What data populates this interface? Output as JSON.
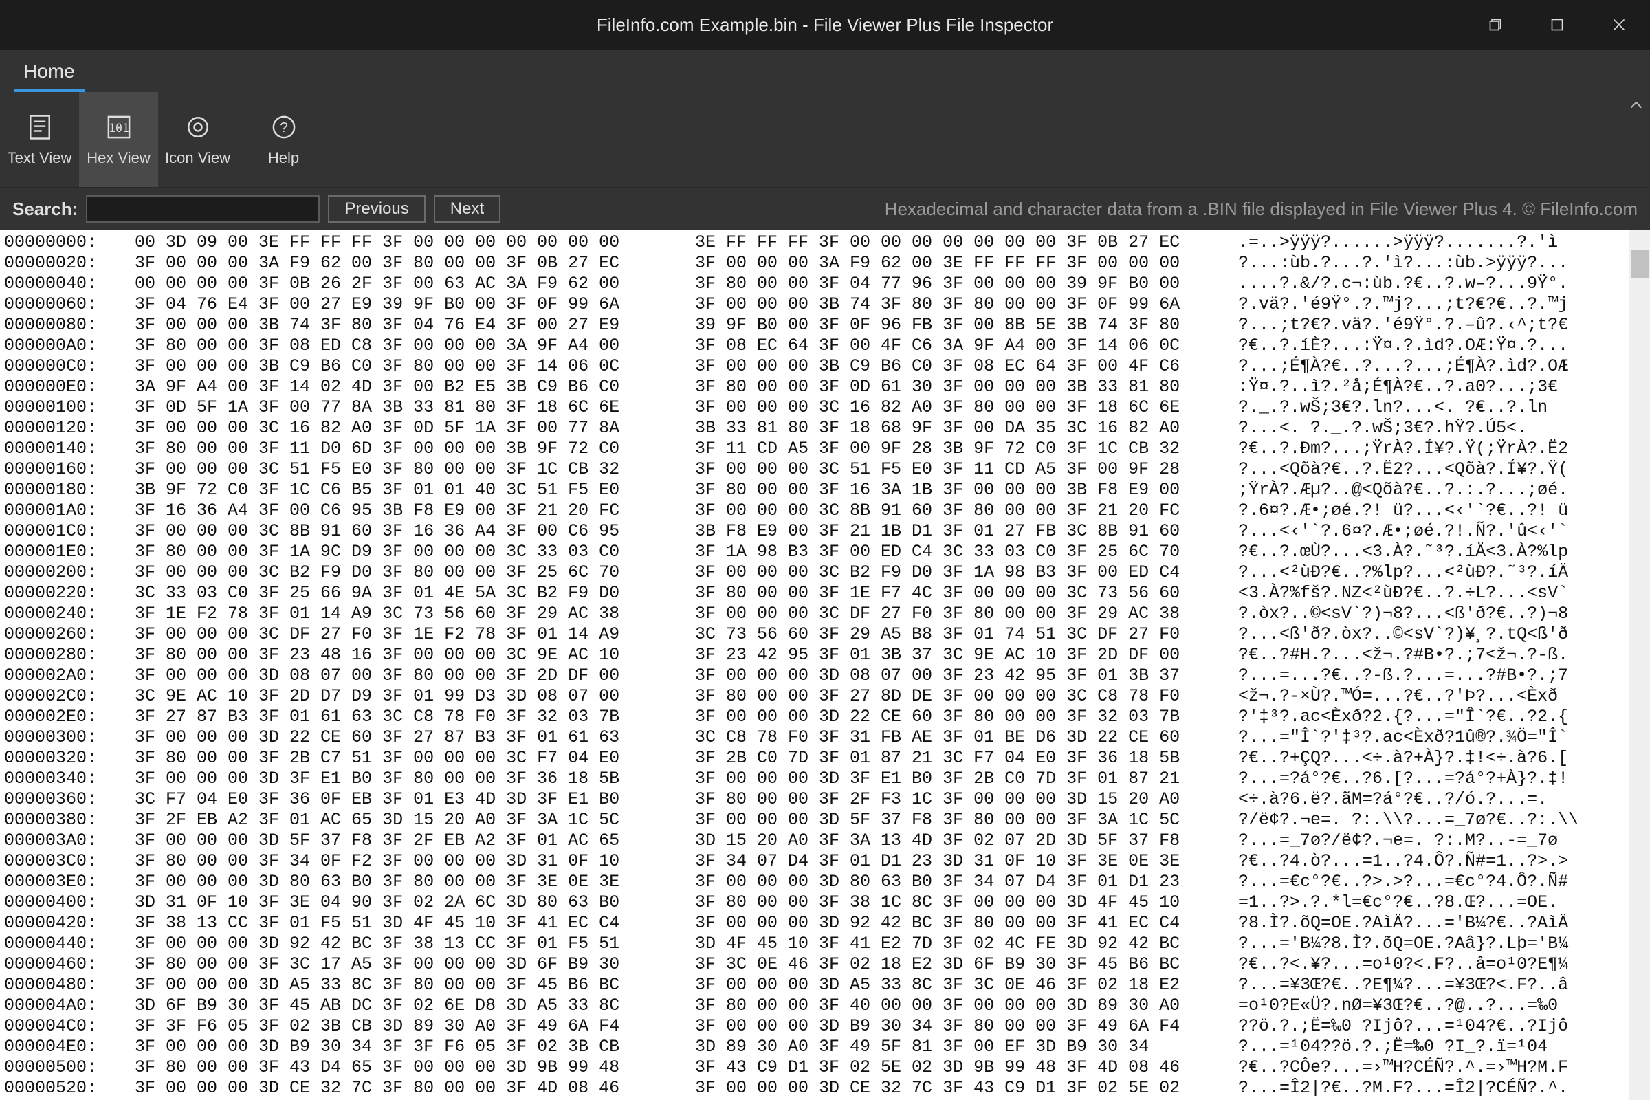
{
  "title": "FileInfo.com Example.bin - File Viewer Plus File Inspector",
  "menu": {
    "home": "Home"
  },
  "toolbar": {
    "text_view": "Text View",
    "hex_view": "Hex View",
    "icon_view": "Icon View",
    "help": "Help"
  },
  "search": {
    "label": "Search:",
    "value": "",
    "previous": "Previous",
    "next": "Next"
  },
  "description": "Hexadecimal and character data from a .BIN file displayed in File Viewer Plus 4. © FileInfo.com",
  "hex_rows": [
    {
      "off": "00000000:",
      "h1": "00 3D 09 00 3E FF FF FF 3F 00 00 00 00 00 00 00",
      "h2": "3E FF FF FF 3F 00 00 00 00 00 00 00 3F 0B 27 EC",
      "a": ".=..>ÿÿÿ?......>ÿÿÿ?.......?.'ì"
    },
    {
      "off": "00000020:",
      "h1": "3F 00 00 00 3A F9 62 00 3F 80 00 00 3F 0B 27 EC",
      "h2": "3F 00 00 00 3A F9 62 00 3E FF FF FF 3F 00 00 00",
      "a": "?...:ùb.?...?.'ì?...:ùb.>ÿÿÿ?..."
    },
    {
      "off": "00000040:",
      "h1": "00 00 00 00 3F 0B 26 2F 3F 00 63 AC 3A F9 62 00",
      "h2": "3F 80 00 00 3F 04 77 96 3F 00 00 00 39 9F B0 00",
      "a": "....?.&/?.c¬:ùb.?€..?.w–?...9Ÿ°."
    },
    {
      "off": "00000060:",
      "h1": "3F 04 76 E4 3F 00 27 E9 39 9F B0 00 3F 0F 99 6A",
      "h2": "3F 00 00 00 3B 74 3F 80 3F 80 00 00 3F 0F 99 6A",
      "a": "?.vä?.'é9Ÿ°.?.™j?...;t?€?€..?.™j"
    },
    {
      "off": "00000080:",
      "h1": "3F 00 00 00 3B 74 3F 80 3F 04 76 E4 3F 00 27 E9",
      "h2": "39 9F B0 00 3F 0F 96 FB 3F 00 8B 5E 3B 74 3F 80",
      "a": "?...;t?€?.vä?.'é9Ÿ°.?.–û?.‹^;t?€"
    },
    {
      "off": "000000A0:",
      "h1": "3F 80 00 00 3F 08 ED C8 3F 00 00 00 3A 9F A4 00",
      "h2": "3F 08 EC 64 3F 00 4F C6 3A 9F A4 00 3F 14 06 0C",
      "a": "?€..?.íÈ?...:Ÿ¤.?.ìd?.OÆ:Ÿ¤.?..."
    },
    {
      "off": "000000C0:",
      "h1": "3F 00 00 00 3B C9 B6 C0 3F 80 00 00 3F 14 06 0C",
      "h2": "3F 00 00 00 3B C9 B6 C0 3F 08 EC 64 3F 00 4F C6",
      "a": "?...;É¶À?€..?...?...;É¶À?.ìd?.OÆ"
    },
    {
      "off": "000000E0:",
      "h1": "3A 9F A4 00 3F 14 02 4D 3F 00 B2 E5 3B C9 B6 C0",
      "h2": "3F 80 00 00 3F 0D 61 30 3F 00 00 00 3B 33 81 80",
      "a": ":Ÿ¤.?..ì?.²å;É¶À?€..?.a0?...;3€"
    },
    {
      "off": "00000100:",
      "h1": "3F 0D 5F 1A 3F 00 77 8A 3B 33 81 80 3F 18 6C 6E",
      "h2": "3F 00 00 00 3C 16 82 A0 3F 80 00 00 3F 18 6C 6E",
      "a": "?._.?.wŠ;3€?.ln?...<. ?€..?.ln"
    },
    {
      "off": "00000120:",
      "h1": "3F 00 00 00 3C 16 82 A0 3F 0D 5F 1A 3F 00 77 8A",
      "h2": "3B 33 81 80 3F 18 68 9F 3F 00 DA 35 3C 16 82 A0",
      "a": "?...<. ?._.?.wŠ;3€?.hŸ?.Ú5<."
    },
    {
      "off": "00000140:",
      "h1": "3F 80 00 00 3F 11 D0 6D 3F 00 00 00 3B 9F 72 C0",
      "h2": "3F 11 CD A5 3F 00 9F 28 3B 9F 72 C0 3F 1C CB 32",
      "a": "?€..?.Ðm?...;ŸrÀ?.Í¥?.Ÿ(;ŸrÀ?.Ë2"
    },
    {
      "off": "00000160:",
      "h1": "3F 00 00 00 3C 51 F5 E0 3F 80 00 00 3F 1C CB 32",
      "h2": "3F 00 00 00 3C 51 F5 E0 3F 11 CD A5 3F 00 9F 28",
      "a": "?...<Qõà?€..?.Ë2?...<Qõà?.Í¥?.Ÿ("
    },
    {
      "off": "00000180:",
      "h1": "3B 9F 72 C0 3F 1C C6 B5 3F 01 01 40 3C 51 F5 E0",
      "h2": "3F 80 00 00 3F 16 3A 1B 3F 00 00 00 3B F8 E9 00",
      "a": ";ŸrÀ?.Æµ?..@<Qõà?€..?.:.?...;øé."
    },
    {
      "off": "000001A0:",
      "h1": "3F 16 36 A4 3F 00 C6 95 3B F8 E9 00 3F 21 20 FC",
      "h2": "3F 00 00 00 3C 8B 91 60 3F 80 00 00 3F 21 20 FC",
      "a": "?.6¤?.Æ•;øé.?! ü?...<‹'`?€..?! ü"
    },
    {
      "off": "000001C0:",
      "h1": "3F 00 00 00 3C 8B 91 60 3F 16 36 A4 3F 00 C6 95",
      "h2": "3B F8 E9 00 3F 21 1B D1 3F 01 27 FB 3C 8B 91 60",
      "a": "?...<‹'`?.6¤?.Æ•;øé.?!.Ñ?.'û<‹'`"
    },
    {
      "off": "000001E0:",
      "h1": "3F 80 00 00 3F 1A 9C D9 3F 00 00 00 3C 33 03 C0",
      "h2": "3F 1A 98 B3 3F 00 ED C4 3C 33 03 C0 3F 25 6C 70",
      "a": "?€..?.œÙ?...<3.À?.˜³?.íÄ<3.À?%lp"
    },
    {
      "off": "00000200:",
      "h1": "3F 00 00 00 3C B2 F9 D0 3F 80 00 00 3F 25 6C 70",
      "h2": "3F 00 00 00 3C B2 F9 D0 3F 1A 98 B3 3F 00 ED C4",
      "a": "?...<²ùÐ?€..?%lp?...<²ùÐ?.˜³?.íÄ"
    },
    {
      "off": "00000220:",
      "h1": "3C 33 03 C0 3F 25 66 9A 3F 01 4E 5A 3C B2 F9 D0",
      "h2": "3F 80 00 00 3F 1E F7 4C 3F 00 00 00 3C 73 56 60",
      "a": "<3.À?%fš?.NZ<²ùÐ?€..?.÷L?...<sV`"
    },
    {
      "off": "00000240:",
      "h1": "3F 1E F2 78 3F 01 14 A9 3C 73 56 60 3F 29 AC 38",
      "h2": "3F 00 00 00 3C DF 27 F0 3F 80 00 00 3F 29 AC 38",
      "a": "?.òx?..©<sV`?)¬8?...<ß'ð?€..?)¬8"
    },
    {
      "off": "00000260:",
      "h1": "3F 00 00 00 3C DF 27 F0 3F 1E F2 78 3F 01 14 A9",
      "h2": "3C 73 56 60 3F 29 A5 B8 3F 01 74 51 3C DF 27 F0",
      "a": "?...<ß'ð?.òx?..©<sV`?)¥¸?.tQ<ß'ð"
    },
    {
      "off": "00000280:",
      "h1": "3F 80 00 00 3F 23 48 16 3F 00 00 00 3C 9E AC 10",
      "h2": "3F 23 42 95 3F 01 3B 37 3C 9E AC 10 3F 2D DF 00",
      "a": "?€..?#H.?...<ž¬.?#B•?.;7<ž¬.?-ß."
    },
    {
      "off": "000002A0:",
      "h1": "3F 00 00 00 3D 08 07 00 3F 80 00 00 3F 2D DF 00",
      "h2": "3F 00 00 00 3D 08 07 00 3F 23 42 95 3F 01 3B 37",
      "a": "?...=...?€..?-ß.?...=...?#B•?.;7"
    },
    {
      "off": "000002C0:",
      "h1": "3C 9E AC 10 3F 2D D7 D9 3F 01 99 D3 3D 08 07 00",
      "h2": "3F 80 00 00 3F 27 8D DE 3F 00 00 00 3C C8 78 F0",
      "a": "<ž¬.?-×Ù?.™Ó=...?€..?'Þ?...<Èxð"
    },
    {
      "off": "000002E0:",
      "h1": "3F 27 87 B3 3F 01 61 63 3C C8 78 F0 3F 32 03 7B",
      "h2": "3F 00 00 00 3D 22 CE 60 3F 80 00 00 3F 32 03 7B",
      "a": "?'‡³?.ac<Èxð?2.{?...=\"Î`?€..?2.{"
    },
    {
      "off": "00000300:",
      "h1": "3F 00 00 00 3D 22 CE 60 3F 27 87 B3 3F 01 61 63",
      "h2": "3C C8 78 F0 3F 31 FB AE 3F 01 BE D6 3D 22 CE 60",
      "a": "?...=\"Î`?'‡³?.ac<Èxð?1û®?.¾Ö=\"Î`"
    },
    {
      "off": "00000320:",
      "h1": "3F 80 00 00 3F 2B C7 51 3F 00 00 00 3C F7 04 E0",
      "h2": "3F 2B C0 7D 3F 01 87 21 3C F7 04 E0 3F 36 18 5B",
      "a": "?€..?+ÇQ?...<÷.à?+À}?.‡!<÷.à?6.["
    },
    {
      "off": "00000340:",
      "h1": "3F 00 00 00 3D 3F E1 B0 3F 80 00 00 3F 36 18 5B",
      "h2": "3F 00 00 00 3D 3F E1 B0 3F 2B C0 7D 3F 01 87 21",
      "a": "?...=?á°?€..?6.[?...=?á°?+À}?.‡!"
    },
    {
      "off": "00000360:",
      "h1": "3C F7 04 E0 3F 36 0F EB 3F 01 E3 4D 3D 3F E1 B0",
      "h2": "3F 80 00 00 3F 2F F3 1C 3F 00 00 00 3D 15 20 A0",
      "a": "<÷.à?6.ë?.ãM=?á°?€..?/ó.?...=."
    },
    {
      "off": "00000380:",
      "h1": "3F 2F EB A2 3F 01 AC 65 3D 15 20 A0 3F 3A 1C 5C",
      "h2": "3F 00 00 00 3D 5F 37 F8 3F 80 00 00 3F 3A 1C 5C",
      "a": "?/ë¢?.¬e=. ?:.\\\\?...=_7ø?€..?:.\\\\"
    },
    {
      "off": "000003A0:",
      "h1": "3F 00 00 00 3D 5F 37 F8 3F 2F EB A2 3F 01 AC 65",
      "h2": "3D 15 20 A0 3F 3A 13 4D 3F 02 07 2D 3D 5F 37 F8",
      "a": "?...=_7ø?/ë¢?.¬e=. ?:.M?..-=_7ø"
    },
    {
      "off": "000003C0:",
      "h1": "3F 80 00 00 3F 34 0F F2 3F 00 00 00 3D 31 0F 10",
      "h2": "3F 34 07 D4 3F 01 D1 23 3D 31 0F 10 3F 3E 0E 3E",
      "a": "?€..?4.ò?...=1..?4.Ô?.Ñ#=1..?>.>"
    },
    {
      "off": "000003E0:",
      "h1": "3F 00 00 00 3D 80 63 B0 3F 80 00 00 3F 3E 0E 3E",
      "h2": "3F 00 00 00 3D 80 63 B0 3F 34 07 D4 3F 01 D1 23",
      "a": "?...=€c°?€..?>.>?...=€c°?4.Ô?.Ñ#"
    },
    {
      "off": "00000400:",
      "h1": "3D 31 0F 10 3F 3E 04 90 3F 02 2A 6C 3D 80 63 B0",
      "h2": "3F 80 00 00 3F 38 1C 8C 3F 00 00 00 3D 4F 45 10",
      "a": "=1..?>.?.*l=€c°?€..?8.Œ?...=OE."
    },
    {
      "off": "00000420:",
      "h1": "3F 38 13 CC 3F 01 F5 51 3D 4F 45 10 3F 41 EC C4",
      "h2": "3F 00 00 00 3D 92 42 BC 3F 80 00 00 3F 41 EC C4",
      "a": "?8.Ì?.õQ=OE.?AìÄ?...='B¼?€..?AìÄ"
    },
    {
      "off": "00000440:",
      "h1": "3F 00 00 00 3D 92 42 BC 3F 38 13 CC 3F 01 F5 51",
      "h2": "3D 4F 45 10 3F 41 E2 7D 3F 02 4C FE 3D 92 42 BC",
      "a": "?...='B¼?8.Ì?.õQ=OE.?Aâ}?.Lþ='B¼"
    },
    {
      "off": "00000460:",
      "h1": "3F 80 00 00 3F 3C 17 A5 3F 00 00 00 3D 6F B9 30",
      "h2": "3F 3C 0E 46 3F 02 18 E2 3D 6F B9 30 3F 45 B6 BC",
      "a": "?€..?<.¥?...=o¹0?<.F?..â=o¹0?E¶¼"
    },
    {
      "off": "00000480:",
      "h1": "3F 00 00 00 3D A5 33 8C 3F 80 00 00 3F 45 B6 BC",
      "h2": "3F 00 00 00 3D A5 33 8C 3F 3C 0E 46 3F 02 18 E2",
      "a": "?...=¥3Œ?€..?E¶¼?...=¥3Œ?<.F?..â"
    },
    {
      "off": "000004A0:",
      "h1": "3D 6F B9 30 3F 45 AB DC 3F 02 6E D8 3D A5 33 8C",
      "h2": "3F 80 00 00 3F 40 00 00 3F 00 00 00 3D 89 30 A0",
      "a": "=o¹0?E«Ü?.nØ=¥3Œ?€..?@..?...=‰0"
    },
    {
      "off": "000004C0:",
      "h1": "3F 3F F6 05 3F 02 3B CB 3D 89 30 A0 3F 49 6A F4",
      "h2": "3F 00 00 00 3D B9 30 34 3F 80 00 00 3F 49 6A F4",
      "a": "??ö.?.;Ë=‰0 ?Ijô?...=¹04?€..?Ijô"
    },
    {
      "off": "000004E0:",
      "h1": "3F 00 00 00 3D B9 30 34 3F 3F F6 05 3F 02 3B CB",
      "h2": "3D 89 30 A0 3F 49 5F 81 3F 00 EF 3D B9 30 34",
      "a": "?...=¹04??ö.?.;Ë=‰0 ?I_?.ï=¹04"
    },
    {
      "off": "00000500:",
      "h1": "3F 80 00 00 3F 43 D4 65 3F 00 00 00 3D 9B 99 48",
      "h2": "3F 43 C9 D1 3F 02 5E 02 3D 9B 99 48 3F 4D 08 46",
      "a": "?€..?CÔe?...=›™H?CÉÑ?.^.=›™H?M.F"
    },
    {
      "off": "00000520:",
      "h1": "3F 00 00 00 3D CE 32 7C 3F 80 00 00 3F 4D 08 46",
      "h2": "3F 00 00 00 3D CE 32 7C 3F 43 C9 D1 3F 02 5E 02",
      "a": "?...=Î2|?€..?M.F?...=Î2|?CÉÑ?.^."
    }
  ]
}
